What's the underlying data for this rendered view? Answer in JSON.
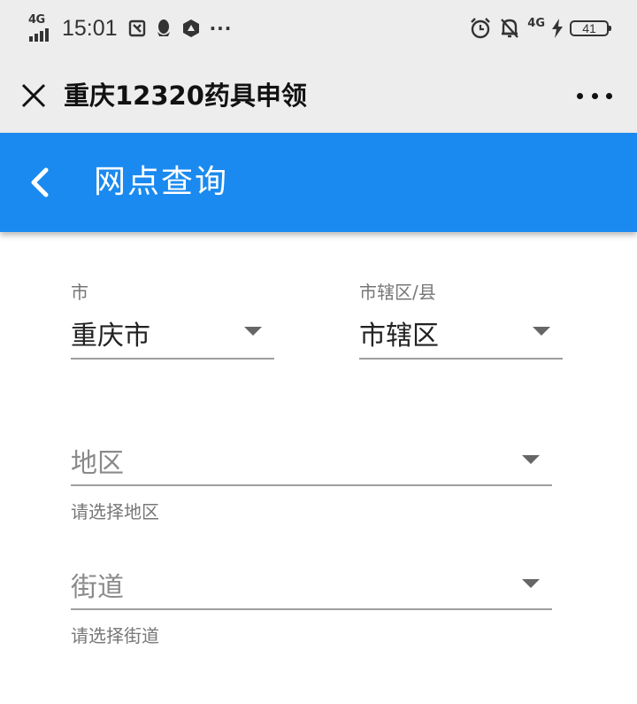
{
  "status_bar": {
    "network_left": "4G",
    "time": "15:01",
    "network_right": "4G",
    "battery": "41",
    "more": "···"
  },
  "title_bar": {
    "title": "重庆12320药具申领"
  },
  "header": {
    "title": "网点查询"
  },
  "form": {
    "city": {
      "label": "市",
      "value": "重庆市"
    },
    "district": {
      "label": "市辖区/县",
      "value": "市辖区"
    },
    "area": {
      "placeholder": "地区",
      "helper": "请选择地区"
    },
    "street": {
      "placeholder": "街道",
      "helper": "请选择街道"
    }
  },
  "colors": {
    "header_bg": "#1a8af0",
    "titlebar_bg": "#ededed",
    "underline": "#9e9e9e"
  }
}
